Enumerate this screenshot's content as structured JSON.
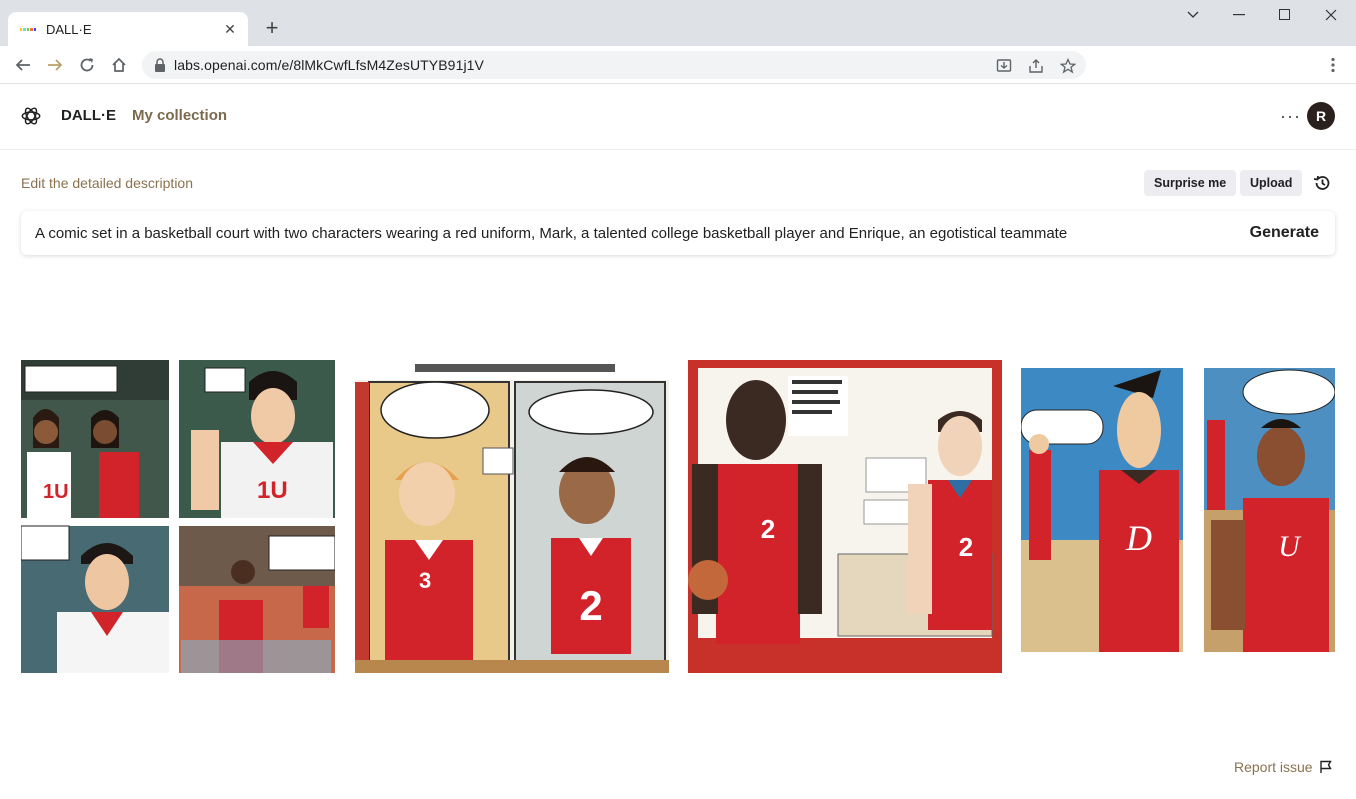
{
  "browser": {
    "tab_title": "DALL·E",
    "url": "labs.openai.com/e/8lMkCwfLfsM4ZesUTYB91j1V"
  },
  "app": {
    "brand": "DALL·E",
    "nav_collection": "My collection",
    "avatar_initial": "R"
  },
  "editor": {
    "label": "Edit the detailed description",
    "surprise_label": "Surprise me",
    "upload_label": "Upload",
    "prompt": "A comic set in a basketball court with two characters wearing a red uniform, Mark, a talented college basketball player and Enrique, an egotistical teammate",
    "generate_label": "Generate"
  },
  "results": [
    {
      "jerseys": [
        "1U",
        "1U"
      ]
    },
    {
      "jerseys": [
        "3",
        "2"
      ]
    },
    {
      "jerseys": [
        "2",
        "2"
      ]
    },
    {
      "jerseys": [
        "D",
        "U"
      ]
    }
  ],
  "footer": {
    "report_label": "Report issue"
  },
  "colors": {
    "accent_brown": "#8a7250",
    "jersey_red": "#d3232a",
    "avatar_bg": "#2a211c"
  }
}
